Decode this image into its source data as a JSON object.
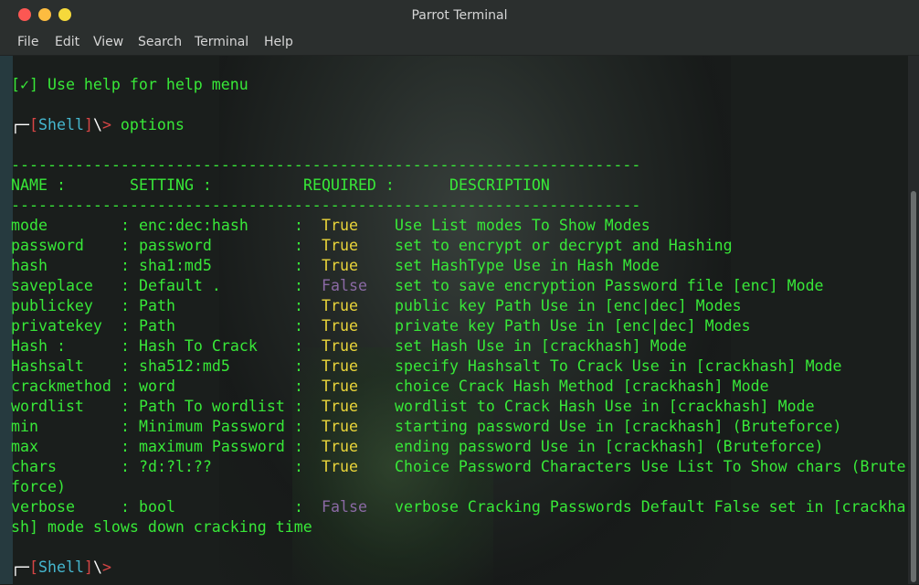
{
  "window": {
    "title": "Parrot Terminal",
    "controls": {
      "close_color": "#fc5753",
      "min_color": "#fdbc40",
      "max_color": "#f5d93b"
    }
  },
  "menu": [
    "File",
    "Edit",
    "View",
    "Search",
    "Terminal",
    "Help"
  ],
  "terminal": {
    "help_line": "[✓] Use help for help menu",
    "prompt1": {
      "corner": "┌─",
      "open": "[",
      "name": "Shell",
      "close": "]",
      "backslash": "\\",
      "arrow": ">",
      "command": " options"
    },
    "separator": "---------------------------------------------------------------------",
    "header": {
      "name": "NAME :",
      "setting": "SETTING :",
      "required": "REQUIRED :",
      "description": "DESCRIPTION"
    },
    "rows": [
      {
        "name": "mode",
        "setting": ": enc:dec:hash",
        "colon": ":",
        "required": "True",
        "description": "Use List modes To Show Modes"
      },
      {
        "name": "password",
        "setting": ": password",
        "colon": ":",
        "required": "True",
        "description": "set to encrypt or decrypt and Hashing"
      },
      {
        "name": "hash",
        "setting": ": sha1:md5",
        "colon": ":",
        "required": "True",
        "description": "set HashType Use in Hash Mode"
      },
      {
        "name": "saveplace",
        "setting": ": Default .",
        "colon": ":",
        "required": "False",
        "description": "set to save encryption Password file [enc] Mode"
      },
      {
        "name": "publickey",
        "setting": ": Path",
        "colon": ":",
        "required": "True",
        "description": "public key Path Use in [enc|dec] Modes"
      },
      {
        "name": "privatekey",
        "setting": ": Path",
        "colon": ":",
        "required": "True",
        "description": "private key Path Use in [enc|dec] Modes"
      },
      {
        "name": "Hash :",
        "setting": ": Hash To Crack",
        "colon": ":",
        "required": "True",
        "description": "set Hash Use in [crackhash] Mode"
      },
      {
        "name": "Hashsalt",
        "setting": ": sha512:md5",
        "colon": ":",
        "required": "True",
        "description": "specify Hashsalt To Crack Use in [crackhash] Mode"
      },
      {
        "name": "crackmethod",
        "setting": ": word",
        "colon": ":",
        "required": "True",
        "description": "choice Crack Hash Method [crackhash] Mode"
      },
      {
        "name": "wordlist",
        "setting": ": Path To wordlist",
        "colon": ":",
        "required": "True",
        "description": "wordlist to Crack Hash Use in [crackhash] Mode"
      },
      {
        "name": "min",
        "setting": ": Minimum Password",
        "colon": ":",
        "required": "True",
        "description": "starting password Use in [crackhash] (Bruteforce)"
      },
      {
        "name": "max",
        "setting": ": maximum Password",
        "colon": ":",
        "required": "True",
        "description": "ending password Use in [crackhash] (Bruteforce)"
      },
      {
        "name": "chars",
        "setting": ": ?d:?l:??",
        "colon": ":",
        "required": "True",
        "description": "Choice Password Characters Use List To Show chars (Brute"
      },
      {
        "name": "verbose",
        "setting": ": bool",
        "colon": ":",
        "required": "False",
        "description": "verbose Cracking Passwords Default False set in [crackha"
      }
    ],
    "wrap_chars": "force)",
    "wrap_verbose": "sh] mode slows down cracking time",
    "prompt2": {
      "corner": "┌─",
      "open": "[",
      "name": "Shell",
      "close": "]",
      "backslash": "\\",
      "arrow": ">"
    }
  },
  "colors": {
    "text_green": "#38e838",
    "false_purple": "#8b6aa5",
    "shell_cyan": "#45b7cf",
    "bracket_red": "#d64545"
  }
}
